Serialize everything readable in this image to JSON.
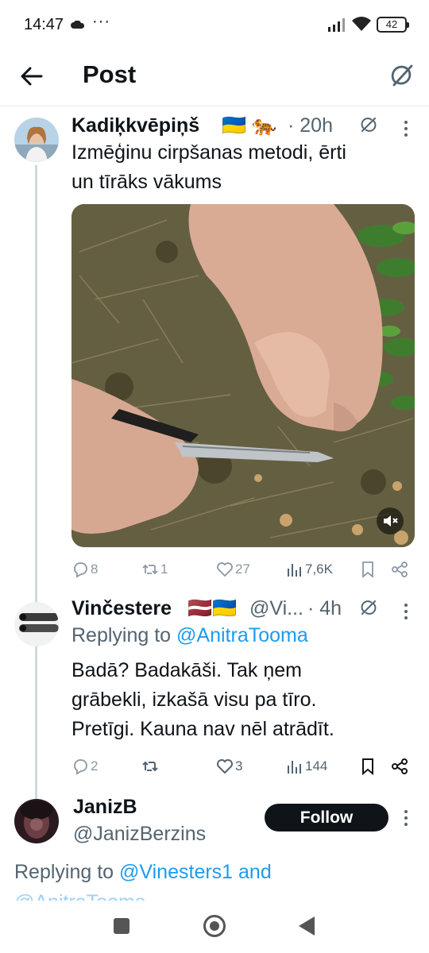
{
  "status_bar": {
    "time": "14:47",
    "dots": "···",
    "battery": "42"
  },
  "header": {
    "title": "Post"
  },
  "main_post": {
    "display_name": "Kadiķkvēpiņš",
    "name_emojis": "🇺🇦 🐅",
    "time": "· 20h",
    "text_line1": "Izmēģinu cirpšanas metodi, ērti",
    "text_line2": "un tīrāks vākums",
    "stats": {
      "replies": "8",
      "reposts": "1",
      "likes": "27",
      "views": "7,6K"
    }
  },
  "reply_post": {
    "display_name": "Vinčestere",
    "name_emojis": "🇱🇻🇺🇦",
    "handle": "@Vi...",
    "time": "· 4h",
    "replying_prefix": "Replying to ",
    "replying_mention": "@AnitraTooma",
    "text_line1": "Badā? Badakāši. Tak ņem",
    "text_line2": "grābekli, izkašā visu pa tīro.",
    "text_line3": "Pretīgi. Kauna nav nēl atrādīt.",
    "stats": {
      "replies": "2",
      "reposts": "",
      "likes": "3",
      "views": "144"
    }
  },
  "third_post": {
    "display_name": "JanizB",
    "handle": "@JanizBerzins",
    "follow_label": "Follow",
    "replying_prefix": "Replying to ",
    "replying_mention": "@Vinesters1 and",
    "cut_line": "@AnitraTooma"
  },
  "colors": {
    "accent": "#1d9bf0",
    "text": "#0f1419",
    "muted": "#536471",
    "thread_line": "#cfd9de"
  }
}
